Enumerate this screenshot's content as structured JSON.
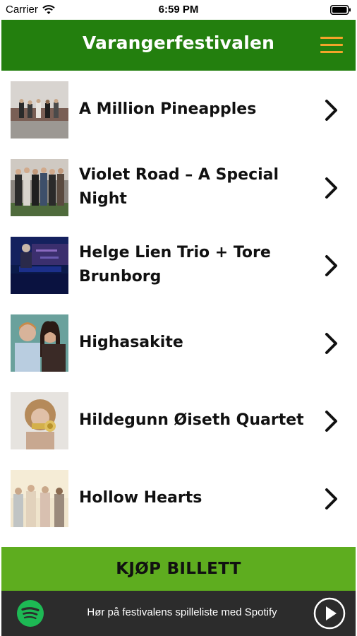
{
  "status_bar": {
    "carrier": "Carrier",
    "time": "6:59 PM",
    "wifi_icon": "wifi-icon",
    "battery_icon": "battery-icon"
  },
  "nav": {
    "title": "Varangerfestivalen",
    "menu_icon": "hamburger-menu-icon",
    "background_color": "#237f0e",
    "menu_color": "#f2a42a"
  },
  "events": [
    {
      "title": "A Million Pineapples",
      "icon": "chevron-right-icon"
    },
    {
      "title": "Violet Road – A Special Night",
      "icon": "chevron-right-icon"
    },
    {
      "title": "Helge Lien Trio + Tore Brunborg",
      "icon": "chevron-right-icon"
    },
    {
      "title": "Highasakite",
      "icon": "chevron-right-icon"
    },
    {
      "title": "Hildegunn Øiseth Quartet",
      "icon": "chevron-right-icon"
    },
    {
      "title": "Hollow Hearts",
      "icon": "chevron-right-icon"
    }
  ],
  "ticket": {
    "label": "KJØP BILLETT",
    "color": "#5ead1f"
  },
  "spotify": {
    "text": "Hør på festivalens spilleliste med Spotify",
    "logo_icon": "spotify-logo-icon",
    "play_icon": "play-icon",
    "logo_color": "#1db954"
  }
}
